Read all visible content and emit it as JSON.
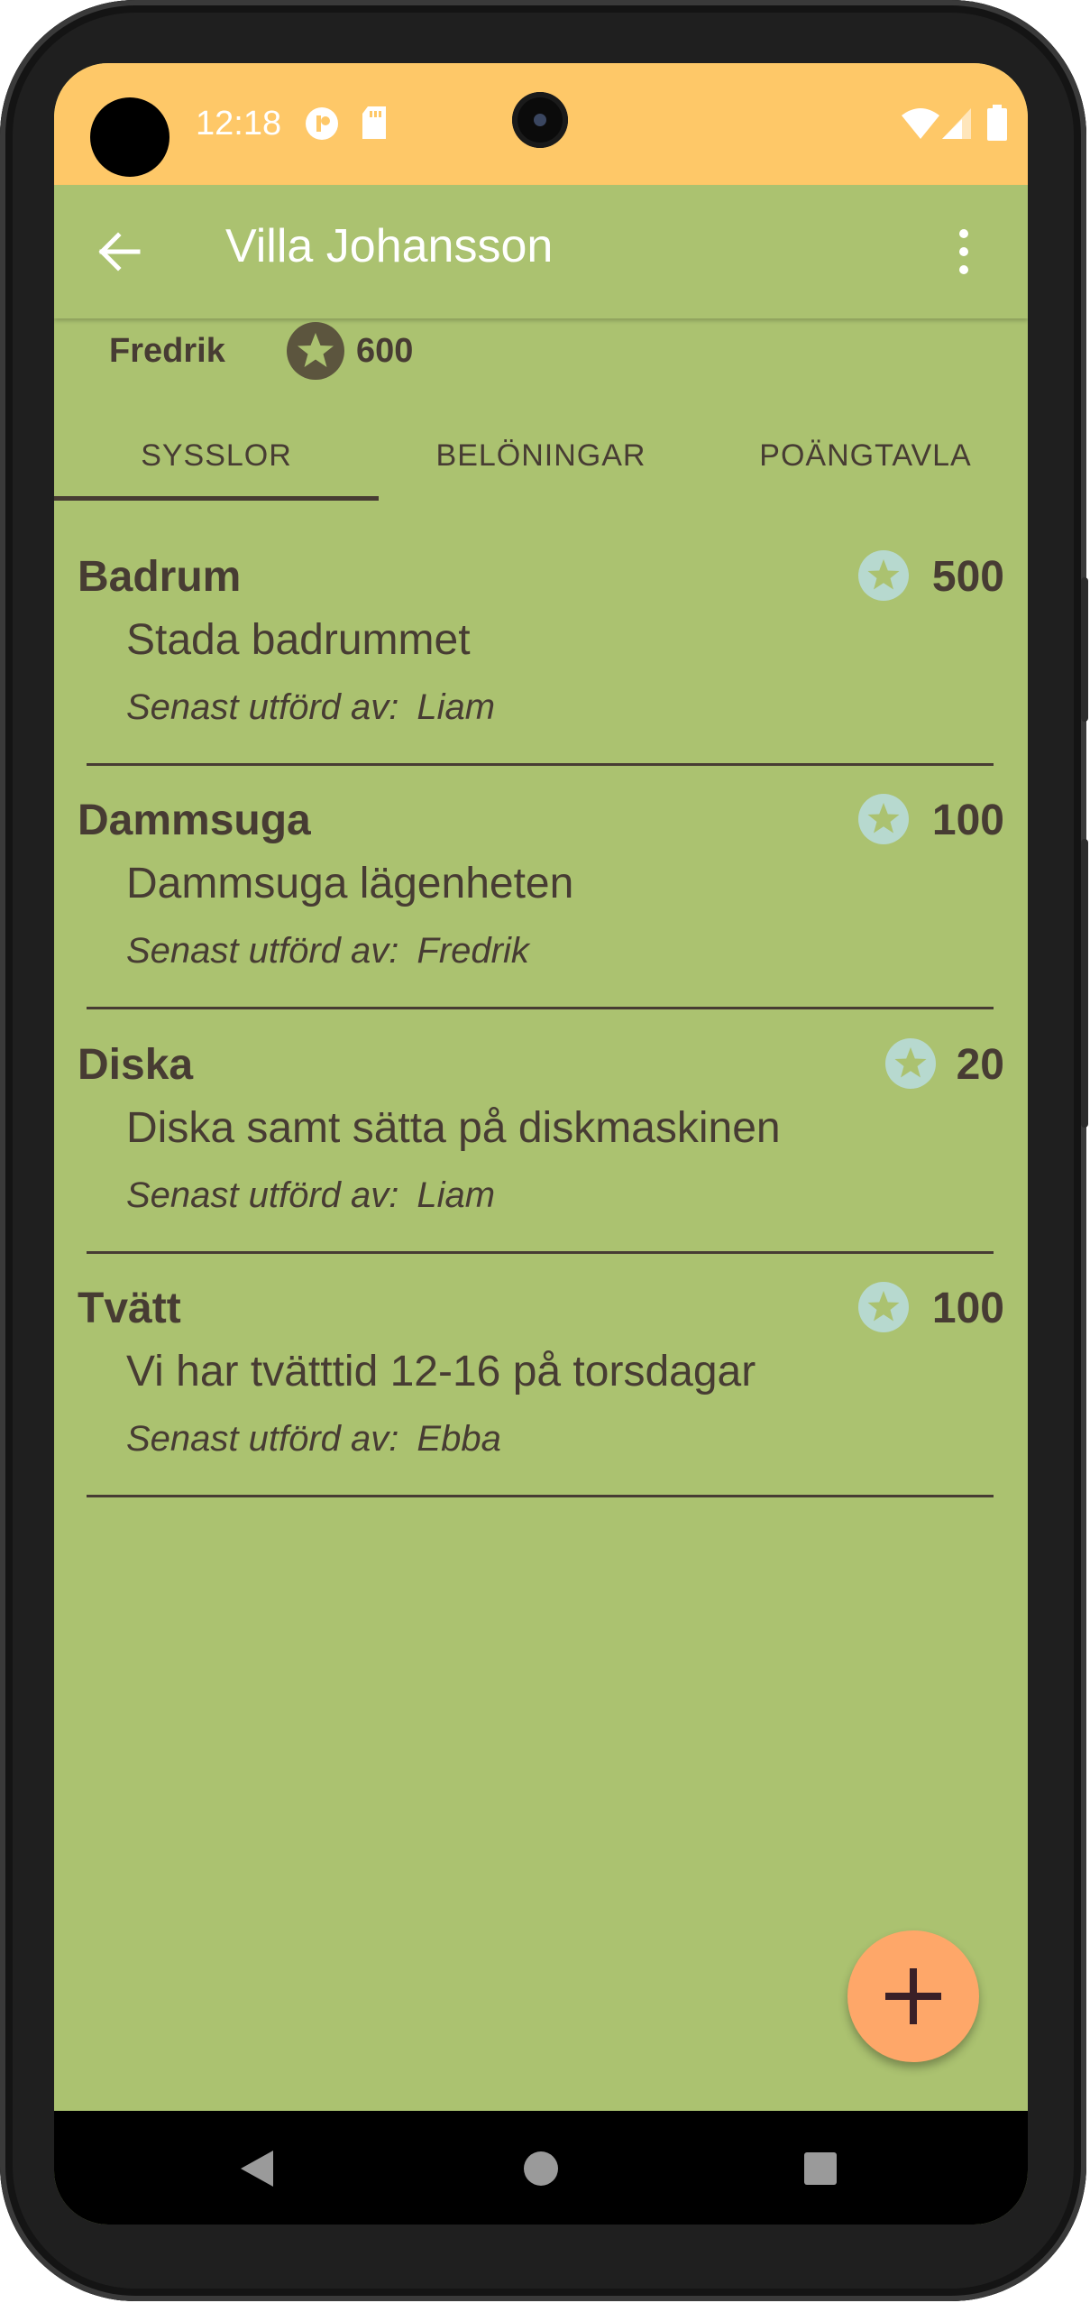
{
  "status_bar": {
    "time": "12:18",
    "left_icons": [
      "badge-notification-icon",
      "sd-card-icon"
    ],
    "right_icons": [
      "wifi-icon",
      "signal-icon",
      "battery-icon"
    ]
  },
  "app_bar": {
    "title": "Villa Johansson",
    "back_icon": "arrow-left-icon",
    "menu_icon": "more-vert-icon"
  },
  "user": {
    "name": "Fredrik",
    "points": "600",
    "star_icon": "star-icon"
  },
  "tabs": [
    {
      "label": "SYSSLOR",
      "selected": true
    },
    {
      "label": "BELÖNINGAR",
      "selected": false
    },
    {
      "label": "POÄNGTAVLA",
      "selected": false
    }
  ],
  "chores": [
    {
      "title": "Badrum",
      "points": "500",
      "description": "Stada badrummet",
      "last_label": "Senast utförd av:",
      "last_by": "Liam"
    },
    {
      "title": "Dammsuga",
      "points": "100",
      "description": "Dammsuga lägenheten",
      "last_label": "Senast utförd av:",
      "last_by": "Fredrik"
    },
    {
      "title": "Diska",
      "points": "20",
      "description": "Diska samt sätta på diskmaskinen",
      "last_label": "Senast utförd av:",
      "last_by": "Liam"
    },
    {
      "title": "Tvätt",
      "points": "100",
      "description": "Vi har tvätttid 12-16 på torsdagar",
      "last_label": "Senast utförd av:",
      "last_by": "Ebba"
    }
  ],
  "fab": {
    "icon": "plus-icon"
  },
  "nav_bar": {
    "icons": [
      "back-triangle-icon",
      "home-circle-icon",
      "recents-square-icon"
    ]
  },
  "colors": {
    "status_bar": "#fec868",
    "background": "#abc270",
    "text": "#473c33",
    "fab": "#fea769",
    "chore_star": "#b7d9cf"
  }
}
